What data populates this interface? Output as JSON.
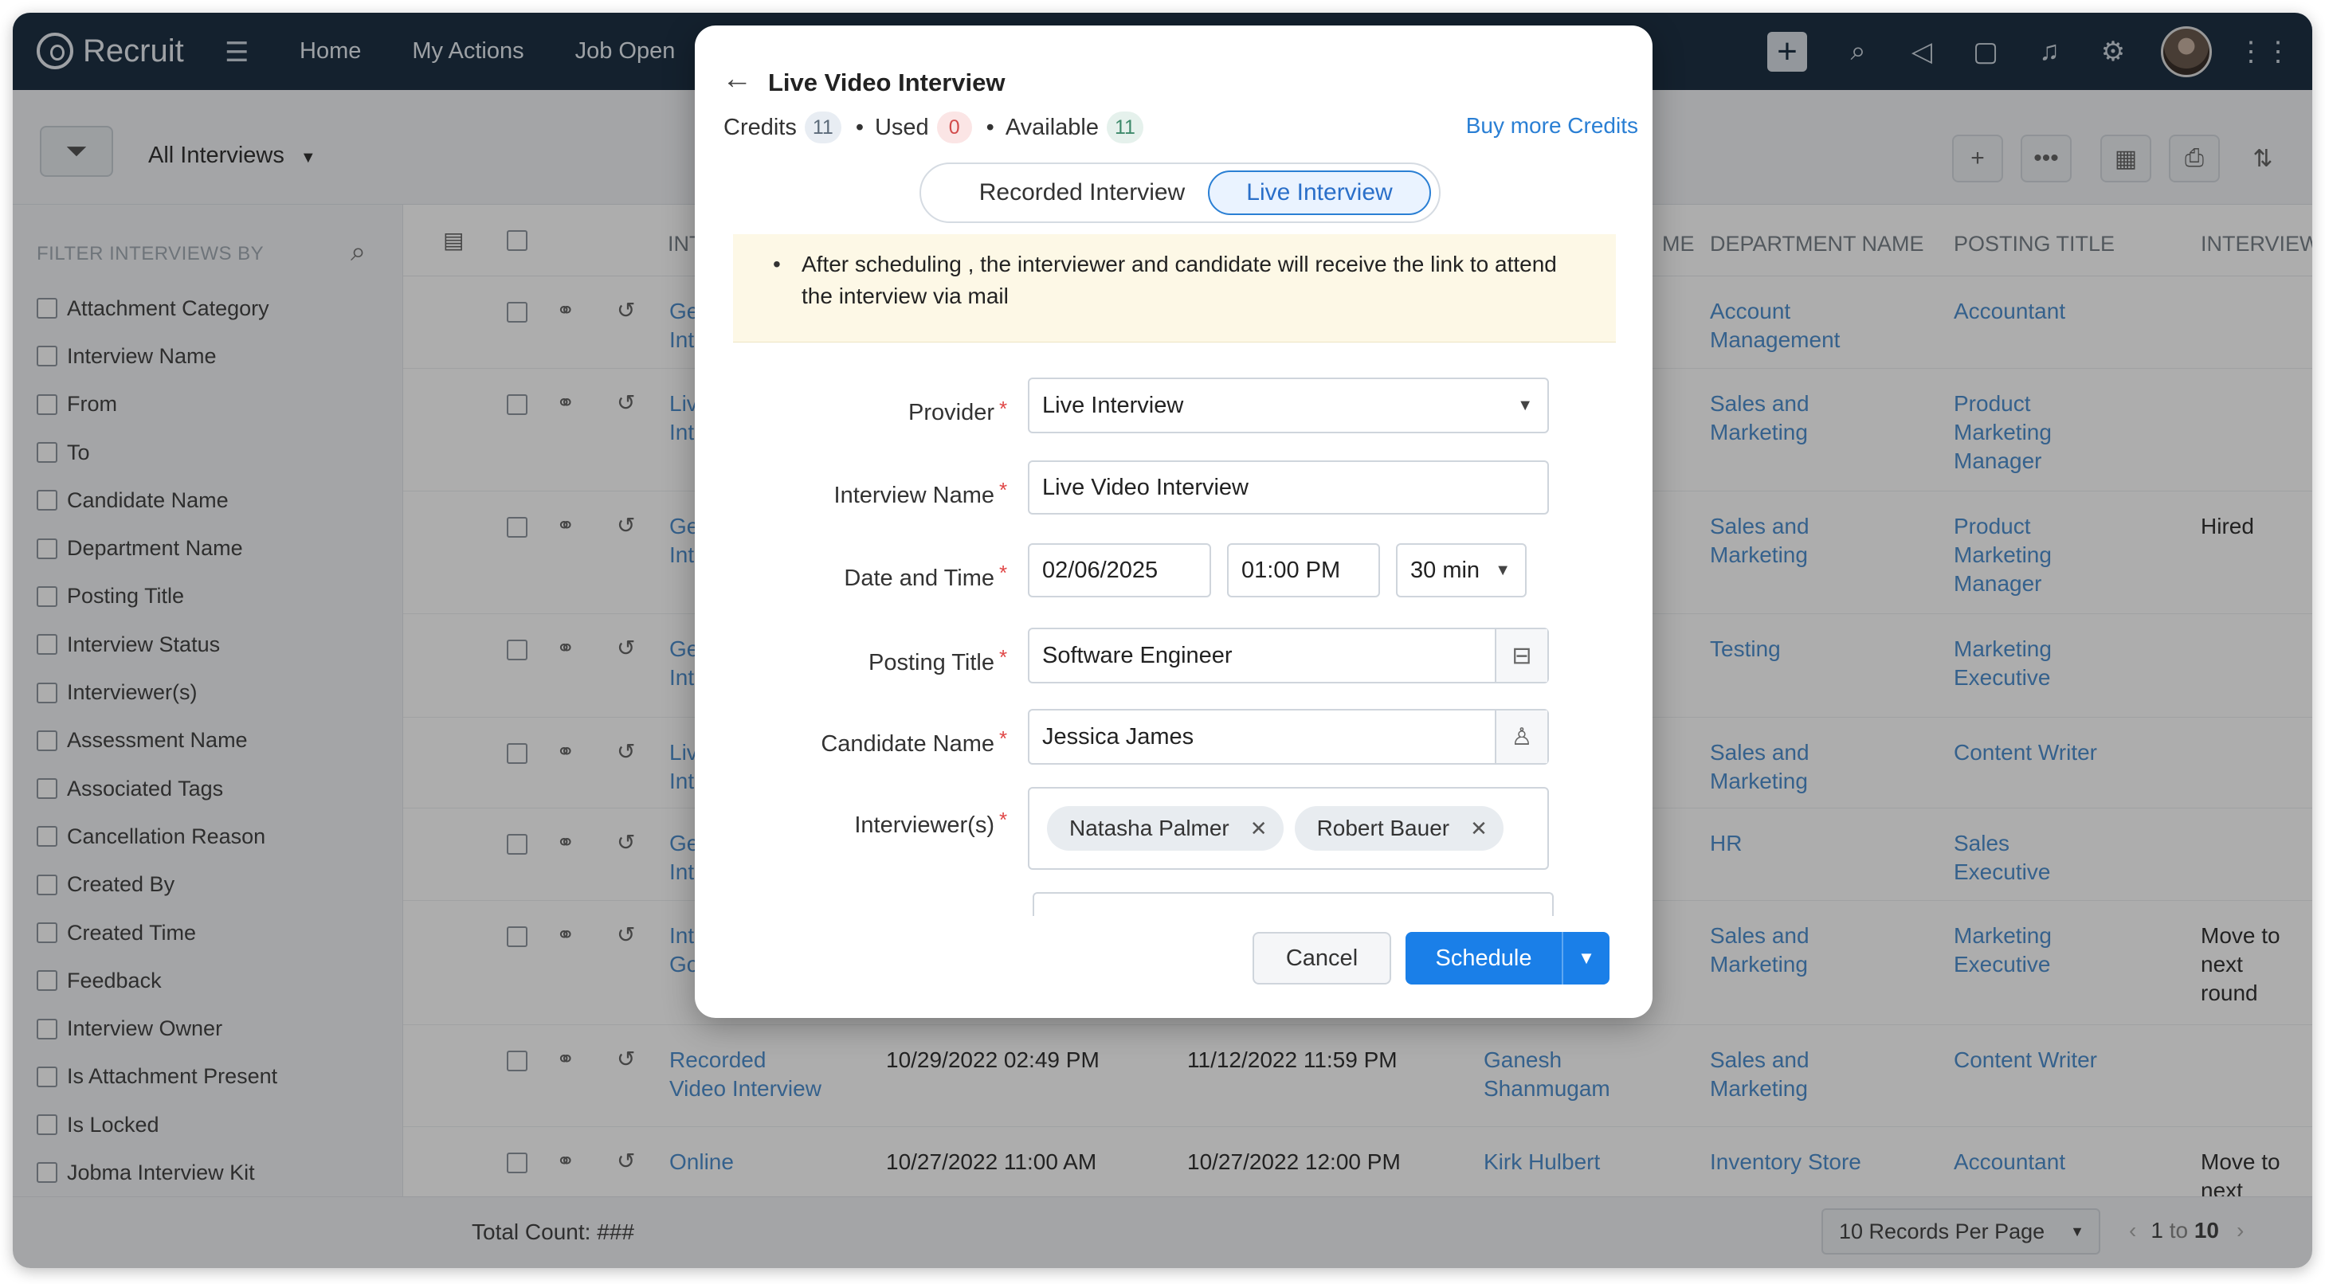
{
  "app": {
    "name": "Recruit"
  },
  "nav": [
    "Home",
    "My Actions",
    "Job Open"
  ],
  "toolbar": {
    "view": "All Interviews"
  },
  "sidebar": {
    "title": "FILTER INTERVIEWS BY",
    "items": [
      "Attachment Category",
      "Interview Name",
      "From",
      "To",
      "Candidate Name",
      "Department Name",
      "Posting Title",
      "Interview Status",
      "Interviewer(s)",
      "Assessment Name",
      "Associated Tags",
      "Cancellation Reason",
      "Created By",
      "Created Time",
      "Feedback",
      "Interview Owner",
      "Is Attachment Present",
      "Is Locked",
      "Jobma Interview Kit"
    ]
  },
  "table": {
    "headers": {
      "int": "INT",
      "me": "ME",
      "dept": "DEPARTMENT NAME",
      "post": "POSTING TITLE",
      "status": "INTERVIEW STA"
    },
    "rows": [
      {
        "name": "Ge\nInt",
        "from": "",
        "to": "",
        "cand": "",
        "dept": "Account\nManagement",
        "post": "Accountant",
        "status": ""
      },
      {
        "name": "Liv\nInt",
        "from": "",
        "to": "",
        "cand": "",
        "dept": "Sales and\nMarketing",
        "post": "Product\nMarketing\nManager",
        "status": ""
      },
      {
        "name": "Ge\nInt",
        "from": "",
        "to": "",
        "cand": "",
        "dept": "Sales and\nMarketing",
        "post": "Product\nMarketing\nManager",
        "status": "Hired"
      },
      {
        "name": "Ge\nInt",
        "from": "",
        "to": "",
        "cand": "",
        "dept": "Testing",
        "post": "Marketing\nExecutive",
        "status": ""
      },
      {
        "name": "Liv\nInt",
        "from": "",
        "to": "",
        "cand": "",
        "dept": "Sales and\nMarketing",
        "post": "Content Writer",
        "status": ""
      },
      {
        "name": "Ge\nInt",
        "from": "",
        "to": "",
        "cand": "",
        "dept": "HR",
        "post": "Sales\nExecutive",
        "status": ""
      },
      {
        "name": "Int\nGo",
        "from": "",
        "to": "",
        "cand": "",
        "dept": "Sales and\nMarketing",
        "post": "Marketing\nExecutive",
        "status": "Move to next\nround"
      },
      {
        "name": "Recorded\nVideo Interview",
        "from": "10/29/2022 02:49 PM",
        "to": "11/12/2022 11:59 PM",
        "cand": "Ganesh\nShanmugam",
        "dept": "Sales and\nMarketing",
        "post": "Content Writer",
        "status": ""
      },
      {
        "name": "Online",
        "from": "10/27/2022 11:00 AM",
        "to": "10/27/2022 12:00 PM",
        "cand": "Kirk Hulbert",
        "dept": "Inventory Store",
        "post": "Accountant",
        "status": "Move to next"
      }
    ]
  },
  "footer": {
    "total": "Total Count: ###",
    "per_page": "10 Records Per Page",
    "pager_from": "1",
    "pager_to_word": "to",
    "pager_to": "10"
  },
  "modal": {
    "title": "Live Video Interview",
    "credits_label": "Credits",
    "credits": "11",
    "used_label": "Used",
    "used": "0",
    "available_label": "Available",
    "available": "11",
    "buy": "Buy more Credits",
    "tab_recorded": "Recorded Interview",
    "tab_live": "Live Interview",
    "note": "After scheduling , the interviewer and candidate will receive the link to attend the interview via mail",
    "provider_label": "Provider",
    "provider": "Live Interview",
    "name_label": "Interview Name",
    "name": "Live Video Interview",
    "date_label": "Date and Time",
    "date": "02/06/2025",
    "time": "01:00 PM",
    "duration": "30 min",
    "posting_label": "Posting Title",
    "posting": "Software Engineer",
    "candidate_label": "Candidate Name",
    "candidate": "Jessica James",
    "interviewers_label": "Interviewer(s)",
    "interviewers": [
      "Natasha Palmer",
      "Robert Bauer"
    ],
    "cancel": "Cancel",
    "schedule": "Schedule"
  },
  "colors": {
    "topbar": "#1e3144",
    "accent": "#1a7fe8",
    "link": "#4f8fcf"
  }
}
